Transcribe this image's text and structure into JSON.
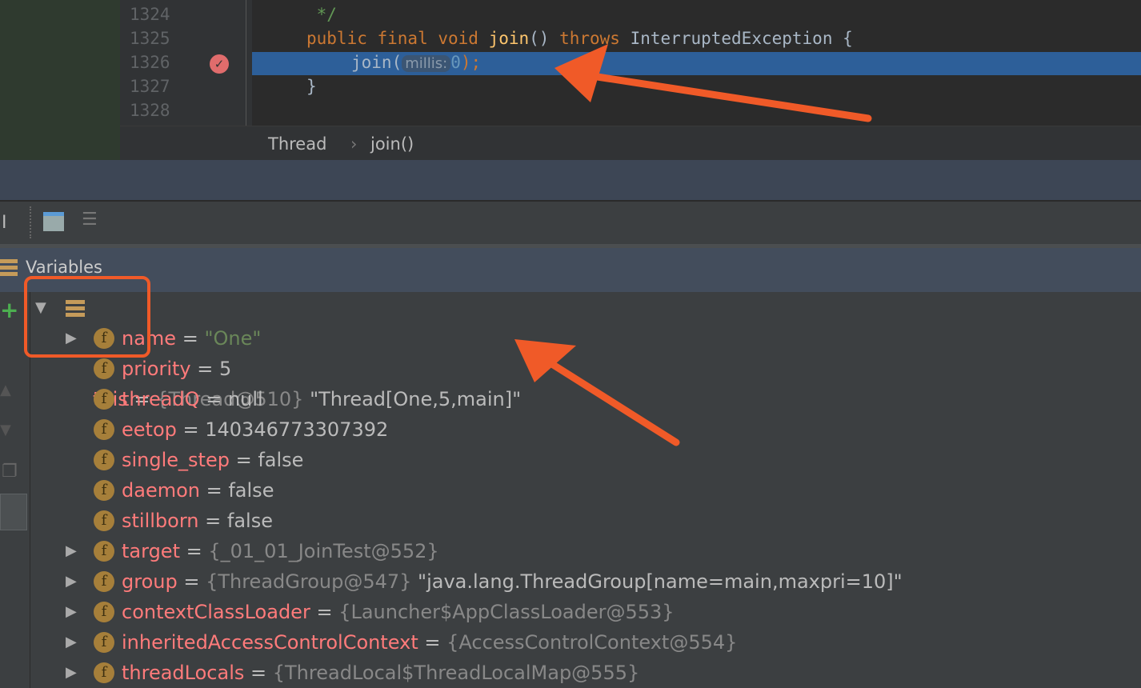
{
  "editor": {
    "lines": [
      {
        "num": "1324",
        "code": " */"
      },
      {
        "num": "1325",
        "code": "public final void join() throws InterruptedException {"
      },
      {
        "num": "1326",
        "code": "join(",
        "hint": "millis:",
        "arg": "0",
        "end": ");"
      },
      {
        "num": "1327",
        "code": "}"
      },
      {
        "num": "1328",
        "code": ""
      }
    ],
    "breadcrumb": [
      "Thread",
      "join()"
    ],
    "breadcrumb_sep": "›"
  },
  "variables": {
    "title": "Variables",
    "root": {
      "name": "this",
      "eq": " = ",
      "ref": "{Thread@510}",
      "value": " \"Thread[One,5,main]\""
    },
    "fields": [
      {
        "name": "name",
        "value": "\"One\"",
        "type": "string",
        "expandable": true
      },
      {
        "name": "priority",
        "value": "5",
        "expandable": false
      },
      {
        "name": "threadQ",
        "value": "null",
        "expandable": false
      },
      {
        "name": "eetop",
        "value": "140346773307392",
        "expandable": false
      },
      {
        "name": "single_step",
        "value": "false",
        "expandable": false
      },
      {
        "name": "daemon",
        "value": "false",
        "expandable": false
      },
      {
        "name": "stillborn",
        "value": "false",
        "expandable": false
      },
      {
        "name": "target",
        "ref": "{_01_01_JoinTest@552}",
        "expandable": true
      },
      {
        "name": "group",
        "ref": "{ThreadGroup@547}",
        "value": " \"java.lang.ThreadGroup[name=main,maxpri=10]\"",
        "expandable": true
      },
      {
        "name": "contextClassLoader",
        "ref": "{Launcher$AppClassLoader@553}",
        "expandable": true
      },
      {
        "name": "inheritedAccessControlContext",
        "ref": "{AccessControlContext@554}",
        "expandable": true
      },
      {
        "name": "threadLocals",
        "ref": "{ThreadLocal$ThreadLocalMap@555}",
        "expandable": true
      }
    ]
  },
  "colors": {
    "annotation": "#f05a28",
    "selection": "#2d5f99"
  }
}
